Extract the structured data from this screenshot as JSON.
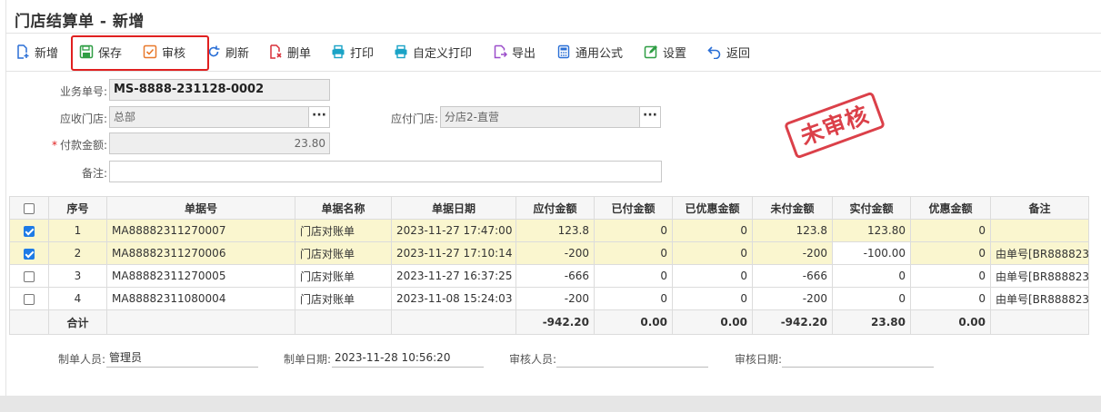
{
  "page": {
    "title": "门店结算单 - 新增"
  },
  "toolbar": {
    "new": "新增",
    "save": "保存",
    "audit": "审核",
    "refresh": "刷新",
    "delete": "删单",
    "print": "打印",
    "custom_print": "自定义打印",
    "export": "导出",
    "formula": "通用公式",
    "settings": "设置",
    "back": "返回"
  },
  "form": {
    "doc_no_label": "业务单号:",
    "doc_no": "MS-8888-231128-0002",
    "recv_store_label": "应收门店:",
    "recv_store": "总部",
    "pay_store_label": "应付门店:",
    "pay_store": "分店2-直营",
    "amount_label": "付款金额:",
    "amount": "23.80",
    "remark_label": "备注:",
    "remark": "",
    "required_mark": "*",
    "dots": "···"
  },
  "stamp": "未审核",
  "table": {
    "headers": [
      "序号",
      "单据号",
      "单据名称",
      "单据日期",
      "应付金额",
      "已付金额",
      "已优惠金额",
      "未付金额",
      "实付金额",
      "优惠金额",
      "备注"
    ],
    "rows": [
      {
        "checked": true,
        "no": "1",
        "doc": "MA88882311270007",
        "name": "门店对账单",
        "date": "2023-11-27 17:47:00",
        "payable": "123.8",
        "paid": "0",
        "discounted": "0",
        "unpaid": "123.8",
        "actual": "123.80",
        "discount": "0",
        "remark": ""
      },
      {
        "checked": true,
        "no": "2",
        "doc": "MA88882311270006",
        "name": "门店对账单",
        "date": "2023-11-27 17:10:14",
        "payable": "-200",
        "paid": "0",
        "discounted": "0",
        "unpaid": "-200",
        "actual": "-100.00",
        "discount": "0",
        "remark": "由单号[BR888823"
      },
      {
        "checked": false,
        "no": "3",
        "doc": "MA88882311270005",
        "name": "门店对账单",
        "date": "2023-11-27 16:37:25",
        "payable": "-666",
        "paid": "0",
        "discounted": "0",
        "unpaid": "-666",
        "actual": "0",
        "discount": "0",
        "remark": "由单号[BR888823"
      },
      {
        "checked": false,
        "no": "4",
        "doc": "MA88882311080004",
        "name": "门店对账单",
        "date": "2023-11-08 15:24:03",
        "payable": "-200",
        "paid": "0",
        "discounted": "0",
        "unpaid": "-200",
        "actual": "0",
        "discount": "0",
        "remark": "由单号[BR888823"
      }
    ],
    "total": {
      "label": "合计",
      "payable": "-942.20",
      "paid": "0.00",
      "discounted": "0.00",
      "unpaid": "-942.20",
      "actual": "23.80",
      "discount": "0.00"
    }
  },
  "footer": {
    "maker_label": "制单人员:",
    "maker": "管理员",
    "make_date_label": "制单日期:",
    "make_date": "2023-11-28 10:56:20",
    "auditor_label": "审核人员:",
    "auditor": "",
    "audit_date_label": "审核日期:",
    "audit_date": ""
  },
  "colors": {
    "accent": "#1e7be6",
    "stamp": "#d9303a",
    "highlight": "#e02020",
    "selected_row": "#faf6cf"
  }
}
